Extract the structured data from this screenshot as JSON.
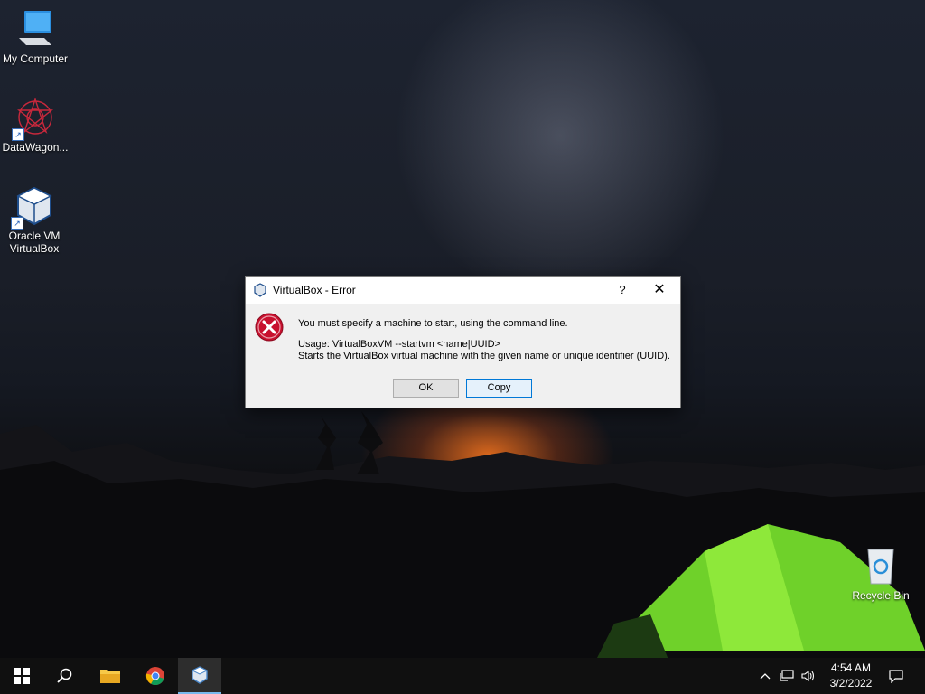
{
  "desktop": {
    "icons": [
      {
        "label": "My Computer",
        "icon": "computer-icon"
      },
      {
        "label": "DataWagon...",
        "icon": "datawagon-icon"
      },
      {
        "label_line1": "Oracle VM",
        "label_line2": "VirtualBox",
        "icon": "virtualbox-icon"
      },
      {
        "label": "Recycle Bin",
        "icon": "recycle-bin-icon"
      }
    ]
  },
  "dialog": {
    "title": "VirtualBox - Error",
    "help_glyph": "?",
    "close_glyph": "✕",
    "message": "You must specify a machine to start, using the command line.",
    "usage": "Usage: VirtualBoxVM --startvm <name|UUID>",
    "description": "Starts the VirtualBox virtual machine with the given name or unique identifier (UUID).",
    "buttons": {
      "ok": "OK",
      "copy": "Copy"
    }
  },
  "taskbar": {
    "time": "4:54 AM",
    "date": "3/2/2022",
    "tray_chevron": "^",
    "accent": "#76b9ed"
  }
}
